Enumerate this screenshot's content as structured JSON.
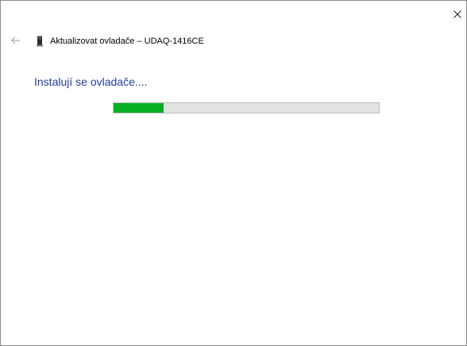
{
  "window": {
    "title": "Aktualizovat ovladače – UDAQ-1416CE",
    "close_icon": "close-icon",
    "back_icon": "back-arrow-icon",
    "device_icon": "device-icon"
  },
  "main": {
    "heading": "Instalují se ovladače....",
    "progress": {
      "percent": 19,
      "fill_color": "#06b025",
      "track_color": "#e3e3e3"
    }
  },
  "colors": {
    "heading": "#1f3f99",
    "back_arrow": "#a0a0a0"
  }
}
